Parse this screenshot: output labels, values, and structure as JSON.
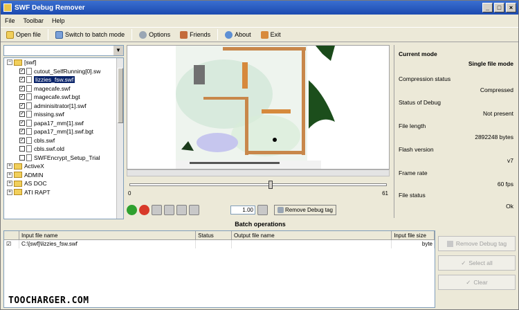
{
  "window": {
    "title": "SWF Debug Remover"
  },
  "menu": [
    "File",
    "Toolbar",
    "Help"
  ],
  "toolbar": {
    "open_file": "Open file",
    "switch_batch": "Switch to batch mode",
    "options": "Options",
    "friends": "Friends",
    "about": "About",
    "exit": "Exit"
  },
  "tree": {
    "items": [
      {
        "label": "[swf]",
        "type": "folder",
        "expanded": true,
        "depth": 0
      },
      {
        "label": "cutout_SelfRunning[0].sw",
        "type": "file",
        "checked": true,
        "depth": 1
      },
      {
        "label": "lizzies_fsw.swf",
        "type": "file",
        "checked": true,
        "depth": 1,
        "selected": true
      },
      {
        "label": "magecafe.swf",
        "type": "file",
        "checked": true,
        "depth": 1
      },
      {
        "label": "magecafe.swf.bgt",
        "type": "file",
        "checked": true,
        "depth": 1
      },
      {
        "label": "adminisitrator[1].swf",
        "type": "file",
        "checked": true,
        "depth": 1
      },
      {
        "label": "missing.swf",
        "type": "file",
        "checked": true,
        "depth": 1
      },
      {
        "label": "papa17_mm[1].swf",
        "type": "file",
        "checked": true,
        "depth": 1
      },
      {
        "label": "papa17_mm[1].swf.bgt",
        "type": "file",
        "checked": true,
        "depth": 1
      },
      {
        "label": "cbls.swf",
        "type": "file",
        "checked": true,
        "depth": 1
      },
      {
        "label": "cbls.swf.old",
        "type": "file",
        "checked": false,
        "depth": 1
      },
      {
        "label": "SWFEncrypt_Setup_Trial",
        "type": "file",
        "checked": false,
        "depth": 1
      },
      {
        "label": "ActiveX",
        "type": "folder",
        "expanded": false,
        "depth": 0
      },
      {
        "label": "ADMIN",
        "type": "folder",
        "expanded": false,
        "depth": 0
      },
      {
        "label": "AS DOC",
        "type": "folder",
        "expanded": false,
        "depth": 0
      },
      {
        "label": "ATI RAPT",
        "type": "folder",
        "expanded": false,
        "depth": 0
      }
    ]
  },
  "player": {
    "frame_start": "0",
    "frame_end": "61",
    "speed": "1.00",
    "remove_debug_label": "Remove Debug tag"
  },
  "info": {
    "current_mode_label": "Current mode",
    "current_mode_value": "Single file mode",
    "compression_label": "Compression status",
    "compression_value": "Compressed",
    "debug_label": "Status of Debug",
    "debug_value": "Not present",
    "length_label": "File length",
    "length_value": "2892248 bytes",
    "flash_label": "Flash version",
    "flash_value": "v7",
    "frame_rate_label": "Frame rate",
    "frame_rate_value": "60 fps",
    "file_status_label": "File status",
    "file_status_value": "Ok"
  },
  "batch": {
    "title": "Batch operations",
    "columns": [
      "",
      "Input file name",
      "Status",
      "Output file name",
      "Input file size"
    ],
    "rows": [
      [
        "",
        "C:\\[swf]\\lizzies_fsw.swf",
        "",
        "",
        "byte"
      ]
    ],
    "buttons": {
      "remove_debug": "Remove Debug tag",
      "select_all": "Select all",
      "clear": "Clear"
    }
  },
  "watermark": "TOOCHARGER.COM",
  "colors": {
    "title_bar": "#1c4ab0",
    "selection": "#0a246a",
    "play": "#2ea02e",
    "stop": "#d83a2a"
  }
}
